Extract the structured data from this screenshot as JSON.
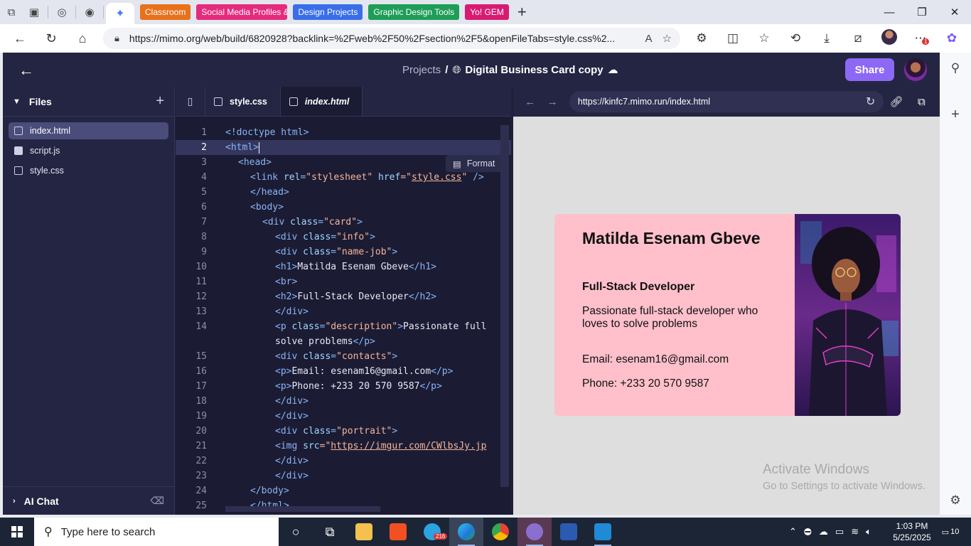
{
  "browser": {
    "tab_chips": [
      {
        "label": "Classroom",
        "color": "#e8711c"
      },
      {
        "label": "Social Media Profiles &",
        "color": "#e52b7d"
      },
      {
        "label": "Design Projects",
        "color": "#3a6ee8"
      },
      {
        "label": "Graphic Design Tools",
        "color": "#1e9d57"
      },
      {
        "label": "Yo! GEM",
        "color": "#d81b72"
      }
    ],
    "url": "https://mimo.org/web/build/6820928?backlink=%2Fweb%2F50%2Fsection%2F5&openFileTabs=style.css%2...",
    "extensions_badge": "1"
  },
  "app": {
    "breadcrumb_root": "Projects",
    "breadcrumb_sep": "/",
    "project_name": "Digital Business Card copy",
    "share_label": "Share",
    "files_title": "Files",
    "files": [
      {
        "name": "index.html",
        "icon": "html5-icon",
        "active": true
      },
      {
        "name": "script.js",
        "icon": "js-icon",
        "active": false
      },
      {
        "name": "style.css",
        "icon": "css3-icon",
        "active": false
      }
    ],
    "ai_chat_label": "AI Chat",
    "editor_tabs": [
      {
        "name": "style.css",
        "active": false
      },
      {
        "name": "index.html",
        "active": true
      }
    ],
    "format_label": "Format",
    "preview_url": "https://kinfc7.mimo.run/index.html"
  },
  "code_lines": [
    {
      "n": "1"
    },
    {
      "n": "2"
    },
    {
      "n": "3"
    },
    {
      "n": "4"
    },
    {
      "n": "5"
    },
    {
      "n": "6"
    },
    {
      "n": "7"
    },
    {
      "n": "8"
    },
    {
      "n": "9"
    },
    {
      "n": "10"
    },
    {
      "n": "11"
    },
    {
      "n": "12"
    },
    {
      "n": "13"
    },
    {
      "n": "14"
    },
    {
      "n": ""
    },
    {
      "n": "15"
    },
    {
      "n": "16"
    },
    {
      "n": "17"
    },
    {
      "n": "18"
    },
    {
      "n": "19"
    },
    {
      "n": "20"
    },
    {
      "n": "21"
    },
    {
      "n": "22"
    },
    {
      "n": "23"
    },
    {
      "n": "24"
    },
    {
      "n": "25"
    }
  ],
  "code": {
    "l1_a": "<!doctype",
    "l1_b": " html",
    "l1_c": ">",
    "l2": "<html>",
    "l3": "<head>",
    "l4_a": "<link",
    "l4_b": " rel",
    "l4_c": "=",
    "l4_d": "\"stylesheet\"",
    "l4_e": " href",
    "l4_f": "=\"",
    "l4_g": "style.css",
    "l4_h": "\"",
    "l4_i": " />",
    "l5": "</head>",
    "l6": "<body>",
    "l7_a": "<div",
    "l7_b": " class",
    "l7_c": "=",
    "l7_d": "\"card\"",
    "l7_e": ">",
    "l8_a": "<div",
    "l8_b": " class",
    "l8_c": "=",
    "l8_d": "\"info\"",
    "l8_e": ">",
    "l9_a": "<div",
    "l9_b": " class",
    "l9_c": "=",
    "l9_d": "\"name-job\"",
    "l9_e": ">",
    "l10_a": "<h1>",
    "l10_b": "Matilda Esenam Gbeve",
    "l10_c": "</h1>",
    "l11": "<br>",
    "l12_a": "<h2>",
    "l12_b": "Full-Stack Developer",
    "l12_c": "</h2>",
    "l13": "</div>",
    "l14_a": "<p",
    "l14_b": " class",
    "l14_c": "=",
    "l14_d": "\"description\"",
    "l14_e": ">",
    "l14_f": "Passionate full",
    "l14w_a": "solve problems",
    "l14w_b": "</p>",
    "l15_a": "<div",
    "l15_b": " class",
    "l15_c": "=",
    "l15_d": "\"contacts\"",
    "l15_e": ">",
    "l16_a": "<p>",
    "l16_b": "Email: esenam16@gmail.com",
    "l16_c": "</p>",
    "l17_a": "<p>",
    "l17_b": "Phone: +233 20 570 9587",
    "l17_c": "</p>",
    "l18": "</div>",
    "l19": "</div>",
    "l20_a": "<div",
    "l20_b": " class",
    "l20_c": "=",
    "l20_d": "\"portrait\"",
    "l20_e": ">",
    "l21_a": "<img",
    "l21_b": " src",
    "l21_c": "=\"",
    "l21_d": "https://imgur.com/CWlbsJy.jp",
    "l22": "</div>",
    "l23": "</div>",
    "l24": "</body>",
    "l25": "</html>"
  },
  "card": {
    "name": "Matilda Esenam Gbeve",
    "title": "Full-Stack Developer",
    "description": "Passionate full-stack developer who loves to solve problems",
    "email": "Email: esenam16@gmail.com",
    "phone": "Phone: +233 20 570 9587",
    "bg_color": "#ffc0cb"
  },
  "watermark": {
    "line1": "Activate Windows",
    "line2": "Go to Settings to activate Windows."
  },
  "taskbar": {
    "search_placeholder": "Type here to search",
    "telegram_badge": "216",
    "time": "1:03 PM",
    "date": "5/25/2025",
    "notifications": "10"
  }
}
